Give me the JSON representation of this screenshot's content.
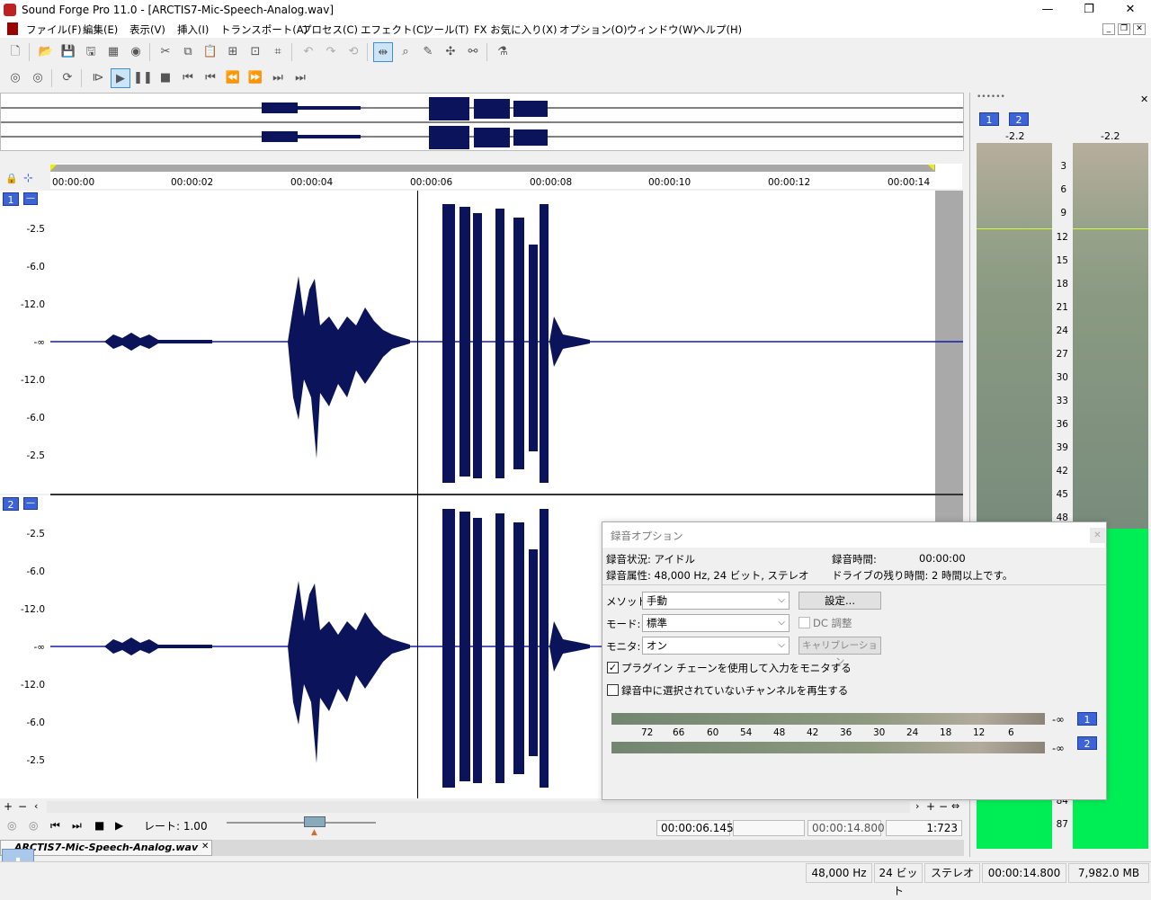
{
  "window": {
    "title": "Sound Forge Pro 11.0 - [ARCTIS7-Mic-Speech-Analog.wav]"
  },
  "menu": [
    "ファイル(F)",
    "編集(E)",
    "表示(V)",
    "挿入(I)",
    "トランスポート(A)",
    "プロセス(C)",
    "エフェクト(C)",
    "ツール(T)",
    "FX お気に入り(X)",
    "オプション(O)",
    "ウィンドウ(W)",
    "ヘルプ(H)"
  ],
  "ruler": {
    "ticks": [
      "00:00:00",
      "00:00:02",
      "00:00:04",
      "00:00:06",
      "00:00:08",
      "00:00:10",
      "00:00:12",
      "00:00:14"
    ]
  },
  "tracks": [
    {
      "channel": "1",
      "scale": [
        "-2.5",
        "-6.0",
        "-12.0",
        "-∞",
        "-12.0",
        "-6.0",
        "-2.5"
      ]
    },
    {
      "channel": "2",
      "scale": [
        "-2.5",
        "-6.0",
        "-12.0",
        "-∞",
        "-12.0",
        "-6.0",
        "-2.5"
      ]
    }
  ],
  "transport": {
    "rate_label": "レート: 1.00",
    "position": "00:00:06.145",
    "length": "00:00:14.800",
    "zoom": "1:723"
  },
  "doc_tab": "ARCTIS7-Mic-Speech-Analog.wav",
  "status": {
    "sample_rate": "48,000 Hz",
    "bit_depth": "24 ビット",
    "channels": "ステレオ",
    "length": "00:00:14.800",
    "free_space": "7,982.0 MB"
  },
  "meters": {
    "peak_values": [
      "-2.2",
      "-2.2"
    ],
    "channels": [
      "1",
      "2"
    ],
    "scale": [
      "3",
      "6",
      "9",
      "12",
      "15",
      "18",
      "21",
      "24",
      "27",
      "30",
      "33",
      "36",
      "39",
      "42",
      "45",
      "48",
      "84",
      "87"
    ]
  },
  "dialog": {
    "title": "録音オプション",
    "status_label": "録音状況: アイドル",
    "attr_label": "録音属性: 48,000 Hz, 24 ビット, ステレオ",
    "rec_time_label": "録音時間:",
    "rec_time_value": "00:00:00",
    "remaining_label": "ドライブの残り時間: 2 時間以上です。",
    "method_label": "メソッド:",
    "method_value": "手動",
    "mode_label": "モード:",
    "mode_value": "標準",
    "monitor_label": "モニタ:",
    "monitor_value": "オン",
    "settings_button": "設定...",
    "dc_label": "DC 調整",
    "calibration_button": "キャリブレーション",
    "check_plugin_label": "プラグイン チェーンを使用して入力をモニタする",
    "check_plugin_checked": true,
    "check_playback_label": "録音中に選択されていないチャンネルを再生する",
    "check_playback_checked": false,
    "meter_scale": [
      "72",
      "66",
      "60",
      "54",
      "48",
      "42",
      "36",
      "30",
      "24",
      "18",
      "12",
      "6"
    ],
    "meter_value": "-∞",
    "meter_channels": [
      "1",
      "2"
    ]
  }
}
